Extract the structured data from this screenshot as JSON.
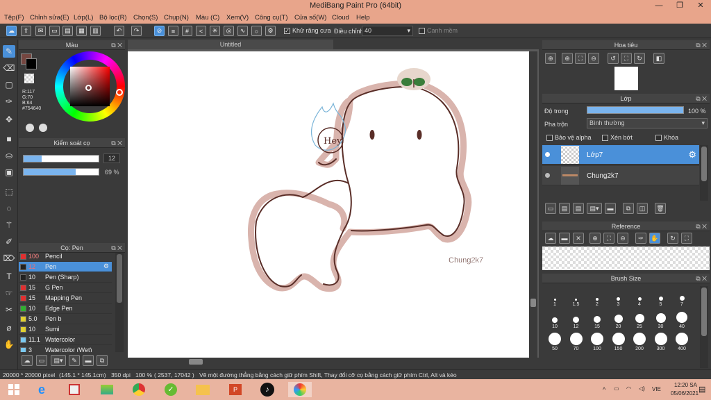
{
  "window": {
    "title": "MediBang Paint Pro (64bit)"
  },
  "menu": [
    "Tệp(F)",
    "Chỉnh sửa(E)",
    "Lớp(L)",
    "Bộ lọc(R)",
    "Chọn(S)",
    "Chụp(N)",
    "Màu (C)",
    "Xem(V)",
    "Công cụ(T)",
    "Cửa số(W)",
    "Cloud",
    "Help"
  ],
  "toolbar": {
    "antialias_label": "Khử răng cưa",
    "correction_label": "Điều chỉnh",
    "correction_value": "40",
    "sharp_edge_label": "Canh mềm"
  },
  "color_panel": {
    "title": "Màu",
    "r": "R:117",
    "g": "G:70",
    "b": "B:64",
    "hex": "#754640",
    "current_color": "#754640"
  },
  "brush_control": {
    "title": "Kiểm soát cọ",
    "size": "12",
    "opacity": "69 %",
    "size_fraction": 0.24,
    "opacity_fraction": 0.69
  },
  "brush_panel": {
    "title": "Cọ: Pen",
    "items": [
      {
        "size": "100",
        "name": "Pencil",
        "color": "#e03030"
      },
      {
        "size": "12",
        "name": "Pen",
        "color": "#222222",
        "selected": true
      },
      {
        "size": "10",
        "name": "Pen (Sharp)",
        "color": "#222222"
      },
      {
        "size": "15",
        "name": "G Pen",
        "color": "#e03030"
      },
      {
        "size": "15",
        "name": "Mapping Pen",
        "color": "#e03030"
      },
      {
        "size": "10",
        "name": "Edge Pen",
        "color": "#30b030"
      },
      {
        "size": "5.0",
        "name": "Pen b",
        "color": "#e0d030"
      },
      {
        "size": "10",
        "name": "Sumi",
        "color": "#e0d030"
      },
      {
        "size": "11.1",
        "name": "Watercolor",
        "color": "#7ac8f0"
      },
      {
        "size": "3",
        "name": "Watercolor (Wet)",
        "color": "#7ac8f0"
      }
    ]
  },
  "canvas": {
    "tab": "Untitled",
    "drawing_text": "Hey",
    "signature": "Chung2k7"
  },
  "navigator": {
    "title": "Hoa tiêu"
  },
  "layer_panel": {
    "title": "Lớp",
    "opacity_label": "Độ trong",
    "opacity_value": "100 %",
    "opacity_fraction": 1.0,
    "blend_label": "Pha trộn",
    "blend_value": "Bình thường",
    "protect_alpha": "Bảo vệ alpha",
    "clipping": "Xén bớt",
    "lock": "Khóa",
    "layers": [
      {
        "name": "Lớp7",
        "selected": true
      },
      {
        "name": "Chung2k7",
        "selected": false
      }
    ]
  },
  "reference": {
    "title": "Reference"
  },
  "brush_size": {
    "title": "Brush Size",
    "sizes": [
      "1",
      "1.5",
      "2",
      "3",
      "4",
      "5",
      "7",
      "10",
      "12",
      "15",
      "20",
      "25",
      "30",
      "40",
      "50",
      "70",
      "100",
      "150",
      "200",
      "300",
      "400"
    ]
  },
  "status": {
    "canvas_size": "20000 * 20000 pixel",
    "physical_size": "(145.1 * 145.1cm)",
    "dpi": "350 dpi",
    "zoom": "100 %",
    "coords": "( 2537, 17042 )",
    "hint": "Vẽ một đường thẳng bằng cách giữ phím Shift, Thay đổi cỡ cọ bằng cách giữ phím Ctrl, Alt và kéo"
  },
  "taskbar": {
    "language": "VIE",
    "time": "12:20 SA",
    "date": "05/06/2021"
  },
  "colors": {
    "accent": "#4a90d9",
    "title_bg": "#e8a58b",
    "outline": "#5a2e28",
    "halo": "#d9b4ad"
  }
}
